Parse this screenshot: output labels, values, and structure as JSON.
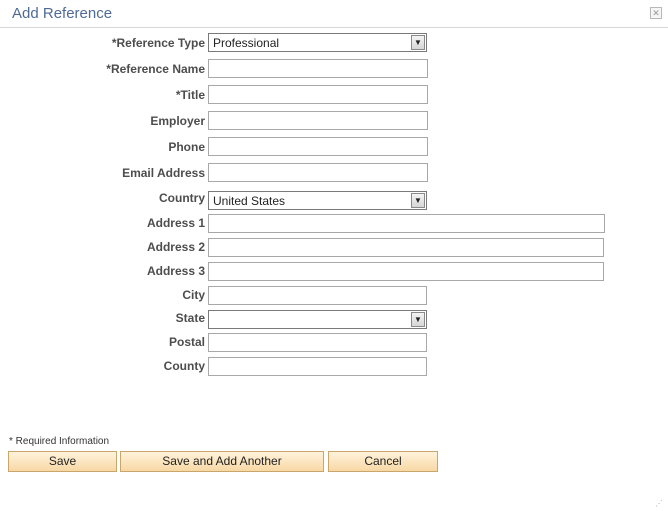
{
  "dialog": {
    "title": "Add Reference",
    "close_glyph": "✕"
  },
  "form": {
    "reference_type": {
      "label": "*Reference Type",
      "value": "Professional"
    },
    "reference_name": {
      "label": "*Reference Name",
      "value": ""
    },
    "title": {
      "label": "*Title",
      "value": ""
    },
    "employer": {
      "label": "Employer",
      "value": ""
    },
    "phone": {
      "label": "Phone",
      "value": ""
    },
    "email": {
      "label": "Email Address",
      "value": ""
    },
    "country": {
      "label": "Country",
      "value": "United States"
    },
    "address1": {
      "label": "Address 1",
      "value": ""
    },
    "address2": {
      "label": "Address 2",
      "value": ""
    },
    "address3": {
      "label": "Address 3",
      "value": ""
    },
    "city": {
      "label": "City",
      "value": ""
    },
    "state": {
      "label": "State",
      "value": ""
    },
    "postal": {
      "label": "Postal",
      "value": ""
    },
    "county": {
      "label": "County",
      "value": ""
    }
  },
  "footer": {
    "required_note": "* Required Information",
    "save_label": "Save",
    "save_add_label": "Save and Add Another",
    "cancel_label": "Cancel"
  },
  "icons": {
    "dropdown": "chevron-down-icon",
    "close": "close-icon",
    "resize": "resize-grip-icon"
  }
}
